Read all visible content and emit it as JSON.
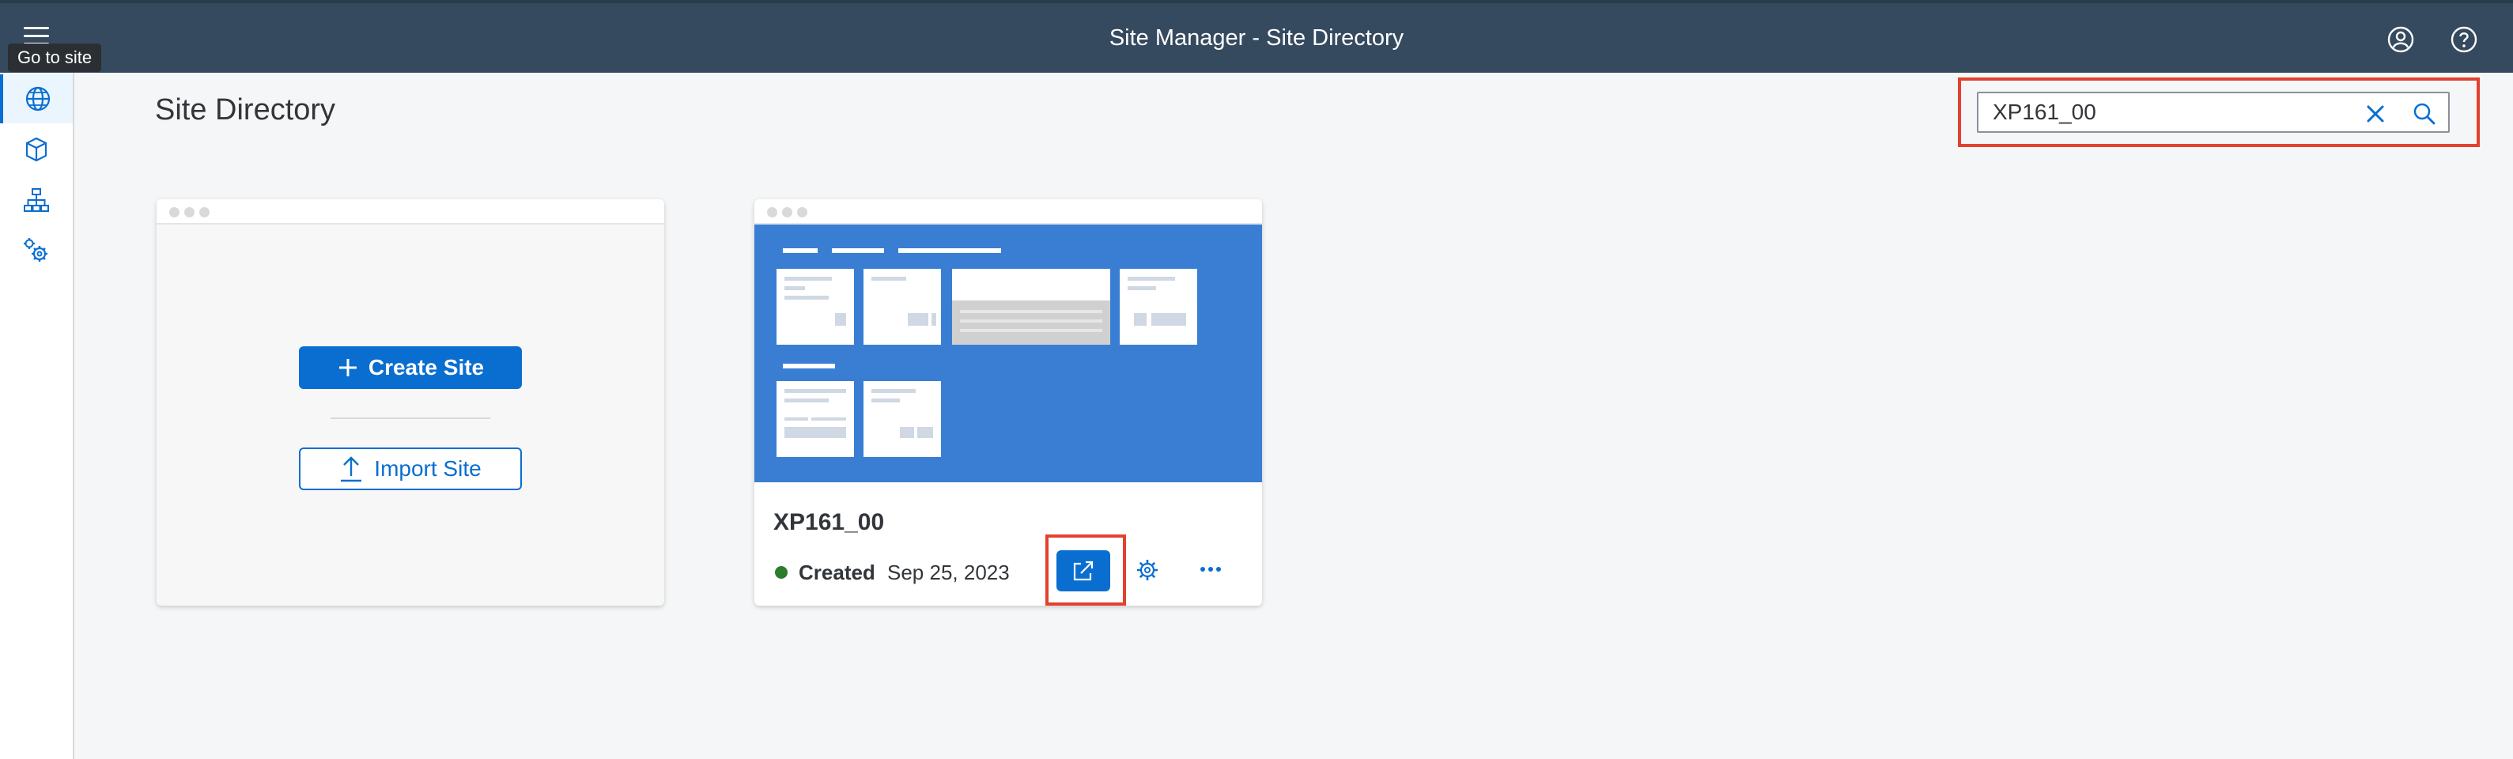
{
  "shell": {
    "title": "Site Manager - Site Directory"
  },
  "tooltip": {
    "text": "Go to site"
  },
  "page": {
    "title": "Site Directory"
  },
  "search": {
    "value": "XP161_00"
  },
  "create_card": {
    "create_label": "Create Site",
    "import_label": "Import Site"
  },
  "sites": [
    {
      "name": "XP161_00",
      "status": "Created",
      "date": "Sep 25, 2023",
      "status_color": "#2b7d2b"
    }
  ],
  "colors": {
    "shell": "#354a5f",
    "accent": "#0a6ed1",
    "highlight": "#e2412f",
    "thumbnail": "#3a7ed4"
  }
}
